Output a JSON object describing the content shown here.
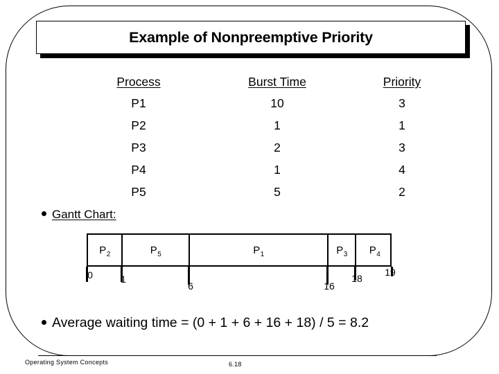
{
  "slide": {
    "title": "Example of Nonpreemptive Priority"
  },
  "table": {
    "headers": {
      "process": "Process",
      "burst_time": "Burst Time",
      "priority": "Priority"
    },
    "rows": [
      {
        "process": "P1",
        "burst_time": "10",
        "priority": "3"
      },
      {
        "process": "P2",
        "burst_time": "1",
        "priority": "1"
      },
      {
        "process": "P3",
        "burst_time": "2",
        "priority": "3"
      },
      {
        "process": "P4",
        "burst_time": "1",
        "priority": "4"
      },
      {
        "process": "P5",
        "burst_time": "5",
        "priority": "2"
      }
    ]
  },
  "gantt": {
    "label": "Gantt Chart:",
    "cells": [
      {
        "name": "P",
        "sub": "2",
        "start": "0",
        "end": "1"
      },
      {
        "name": "P",
        "sub": "5",
        "start": "1",
        "end": "6"
      },
      {
        "name": "P",
        "sub": "1",
        "start": "6",
        "end": "16"
      },
      {
        "name": "P",
        "sub": "3",
        "start": "16",
        "end": "18"
      },
      {
        "name": "P",
        "sub": "4",
        "start": "18",
        "end": "19"
      }
    ],
    "ticks": [
      "0",
      "1",
      "6",
      "16",
      "18",
      "19"
    ]
  },
  "average_waiting": {
    "text": "Average waiting time = (0 + 1 + 6 + 16 + 18) / 5 = 8.2"
  },
  "footer": {
    "left": "Operating System Concepts",
    "page": "6.18"
  },
  "chart_data": {
    "type": "bar",
    "title": "Gantt Chart:",
    "xlabel": "",
    "ylabel": "",
    "xlim": [
      0,
      19
    ],
    "categories": [
      "P2",
      "P5",
      "P1",
      "P3",
      "P4"
    ],
    "values": [
      1,
      5,
      10,
      2,
      1
    ],
    "starts": [
      0,
      1,
      6,
      16,
      18
    ],
    "ends": [
      1,
      6,
      16,
      18,
      19
    ],
    "tick_labels": [
      "0",
      "1",
      "6",
      "16",
      "18",
      "19"
    ],
    "grid": false,
    "legend": "none"
  }
}
